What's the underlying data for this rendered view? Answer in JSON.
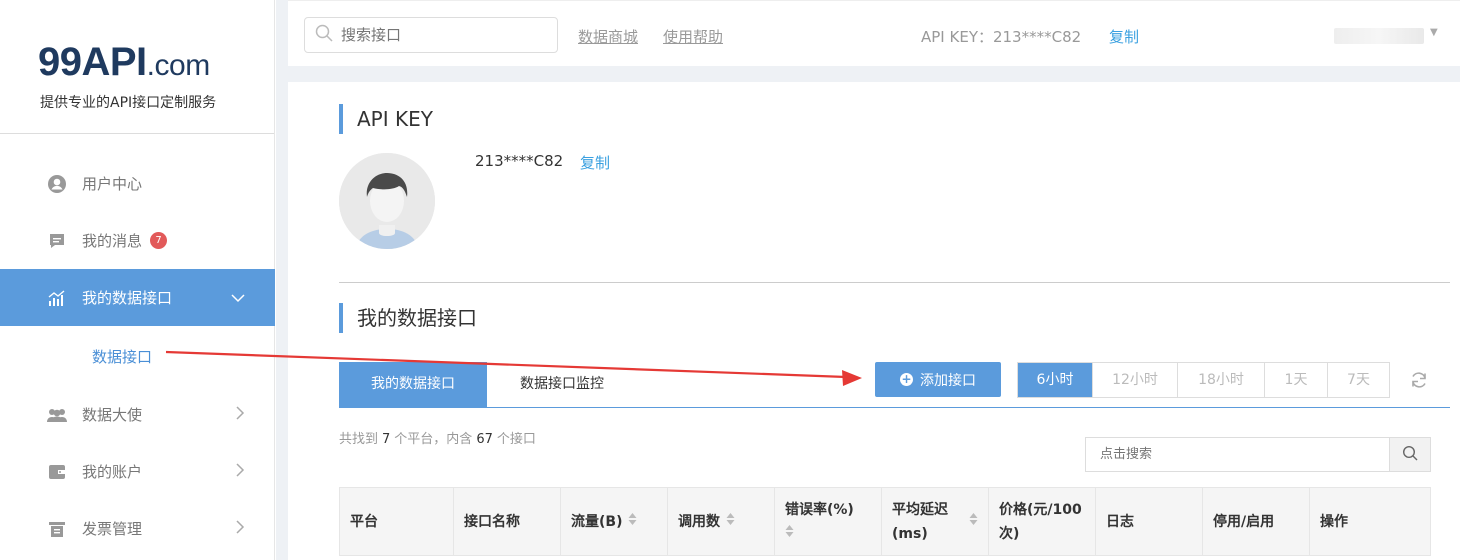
{
  "brand": {
    "name_main": "99API",
    "name_suffix": ".com",
    "tagline": "提供专业的API接口定制服务"
  },
  "sidebar": {
    "items": [
      {
        "label": "用户中心",
        "icon": "user-icon"
      },
      {
        "label": "我的消息",
        "icon": "message-icon",
        "badge": "7"
      },
      {
        "label": "我的数据接口",
        "icon": "chart-icon",
        "active": true
      },
      {
        "label": "数据大使",
        "icon": "group-icon"
      },
      {
        "label": "我的账户",
        "icon": "wallet-icon"
      },
      {
        "label": "发票管理",
        "icon": "invoice-icon"
      }
    ],
    "sub_item": "数据接口"
  },
  "topbar": {
    "search_placeholder": "搜索接口",
    "links": [
      "数据商城",
      "使用帮助"
    ],
    "apikey_text": "API KEY：213****C82",
    "copy_label": "复制"
  },
  "apikey_section": {
    "title": "API KEY",
    "key_value": "213****C82",
    "copy_label": "复制"
  },
  "interfaces_section": {
    "title": "我的数据接口",
    "tabs": [
      "我的数据接口",
      "数据接口监控"
    ],
    "add_button": "添加接口",
    "time_ranges": [
      "6小时",
      "12小时",
      "18小时",
      "1天",
      "7天"
    ],
    "active_range": "6小时",
    "summary": {
      "prefix": "共找到",
      "platforms": "7",
      "mid": "个平台，内含",
      "interfaces": "67",
      "suffix": "个接口"
    },
    "search_placeholder": "点击搜索",
    "columns": [
      "平台",
      "接口名称",
      "流量(B)",
      "调用数",
      "错误率(%)",
      "平均延迟(ms)",
      "价格(元/100次)",
      "日志",
      "停用/启用",
      "操作"
    ]
  },
  "colors": {
    "accent": "#5b9bdc",
    "link": "#3aa0e0",
    "badge": "#e25a5a",
    "annotation_arrow": "#e53935"
  }
}
